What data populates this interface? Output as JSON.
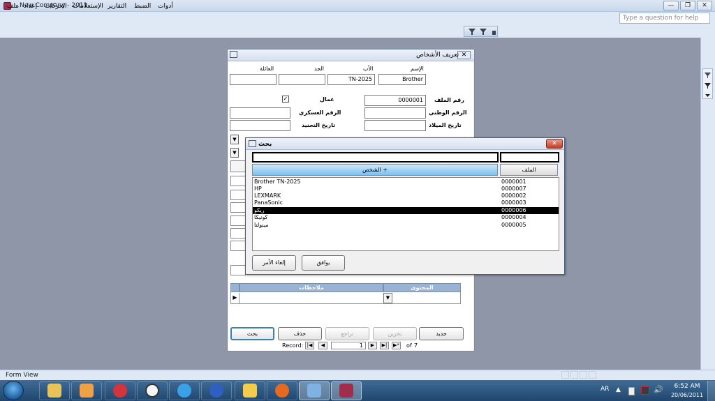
{
  "window": {
    "title": "- New Company - 2011",
    "min": "—",
    "restore": "❐",
    "close": "✕"
  },
  "menu": {
    "items": [
      "ملف",
      "إعداد",
      "الحركات",
      "الإستعلامات",
      "التقارير",
      "الضبط",
      "أدوات"
    ],
    "help_placeholder": "Type a question for help"
  },
  "form": {
    "title": "تعريف الأشخاص",
    "labels": {
      "name": "الإسم",
      "father": "الأب",
      "grandfather": "الجد",
      "family": "العائلة",
      "file_no": "رقم الملف",
      "national_no": "الرقم الوطني",
      "birth_date": "تاريخ الميلاد",
      "workers": "عمال",
      "military_no": "الرقم العسكري",
      "recruit_date": "تاريخ التجنيد",
      "content": "المحتوى",
      "notes": "ملاحظات"
    },
    "values": {
      "name": "Brother",
      "father": "TN-2025",
      "grandfather": "",
      "family": "",
      "file_no": "0000001",
      "national_no": "",
      "birth_date": "",
      "military_no": "",
      "recruit_date": ""
    },
    "buttons": {
      "new": "جديد",
      "save": "تخزين",
      "undo": "تراجع",
      "delete": "حذف",
      "search": "بحث"
    },
    "navigator": {
      "label": "Record:",
      "current": "1",
      "of": "of",
      "total": "7"
    }
  },
  "search_dialog": {
    "title": "بحث",
    "columns": {
      "id": "الملف",
      "name": "الشخص +"
    },
    "rows": [
      {
        "name": "Brother TN-2025",
        "id": "0000001",
        "selected": false
      },
      {
        "name": "HP",
        "id": "0000007",
        "selected": false
      },
      {
        "name": "LEXMARK",
        "id": "0000002",
        "selected": false
      },
      {
        "name": "PanaSonic",
        "id": "0000003",
        "selected": false
      },
      {
        "name": "ريكو",
        "id": "0000006",
        "selected": true
      },
      {
        "name": "كونيكا",
        "id": "0000004",
        "selected": false
      },
      {
        "name": "مينولتا",
        "id": "0000005",
        "selected": false
      }
    ],
    "ok": "يوافق",
    "cancel": "إلغاء الأمر"
  },
  "statusbar": {
    "text": "Form View"
  },
  "taskbar": {
    "lang": "AR",
    "time": "6:52 AM",
    "date": "20/06/2011",
    "apps": [
      "file-explorer",
      "media-player",
      "pin-app",
      "clock-app",
      "internet-explorer",
      "messenger",
      "mail-app",
      "firefox",
      "network-app",
      "access-app"
    ]
  }
}
